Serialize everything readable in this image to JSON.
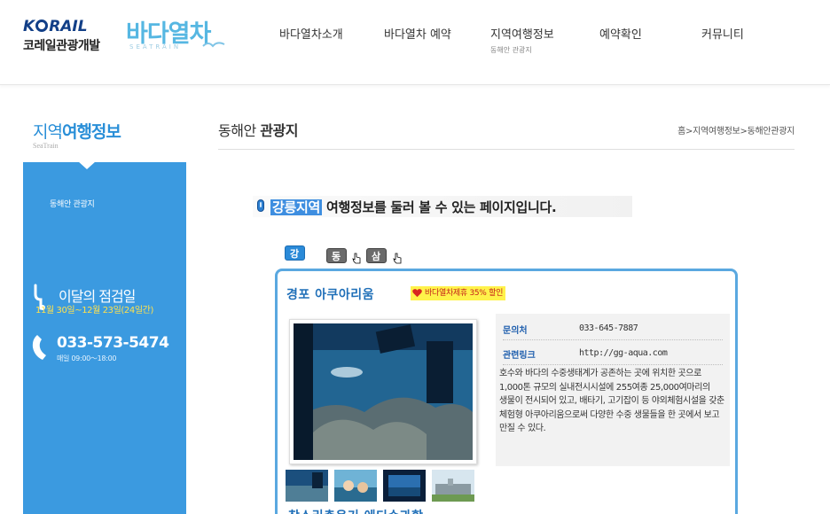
{
  "header": {
    "top_links": [
      "",
      "",
      "",
      ""
    ],
    "korail_logo_en": "K",
    "korail_logo_en2": "RAIL",
    "korail_logo_kr": "코레일관광개발",
    "sea_logo_title": "바다열차",
    "sea_logo_sub": "SEATRAIN",
    "nav": [
      {
        "label": "바다열차소개"
      },
      {
        "label": "바다열차 예약"
      },
      {
        "label": "지역여행정보",
        "sub": "동해안 관광지"
      },
      {
        "label": "예약확인"
      },
      {
        "label": "커뮤니티"
      }
    ]
  },
  "sidebar": {
    "title_a": "지역",
    "title_b": "여행정보",
    "subtitle": "SeaTrain",
    "menu_item": "동해안 관광지",
    "inspection_label": "이달의 점검일",
    "inspection_dates": "11월 30일~12월 23일(24일간)",
    "phone": "033-573-5474",
    "hours": "매일 09:00～18:00"
  },
  "main": {
    "title_plain": "동해안 ",
    "title_bold": "관광지",
    "breadcrumb": "홈>지역여행정보>동해안관광지",
    "intro_highlight": "강릉지역",
    "intro_text": " 여행정보를 둘러 볼 수 있는 페이지입니다.",
    "tabs": [
      "강릉",
      "동해",
      "삼척"
    ],
    "card": {
      "title": "경포 아쿠아리움",
      "badge": "바다열차제휴 35% 할인",
      "contact_label": "문의처",
      "contact_value": "033-645-7887",
      "link_label": "관련링크",
      "link_value": "http://gg-aqua.com",
      "description": "호수와 바다의 수중생태계가 공존하는 곳에 위치한 곳으로 1,000톤 규모의 실내전시시설에 255여종 25,000여마리의 생물이 전시되어 있고, 배타기, 고기잡이 등 야외체험시설을 갖춘 체험형 아쿠아리움으로써 다양한 수중 생물들을 한 곳에서 보고 만질 수 있다."
    },
    "next_title": "참소리축음기 에디슨과학"
  },
  "colors": {
    "brand_blue": "#3b9ae0",
    "title_blue": "#1f6fb8",
    "highlight_yellow": "#fff24a"
  }
}
